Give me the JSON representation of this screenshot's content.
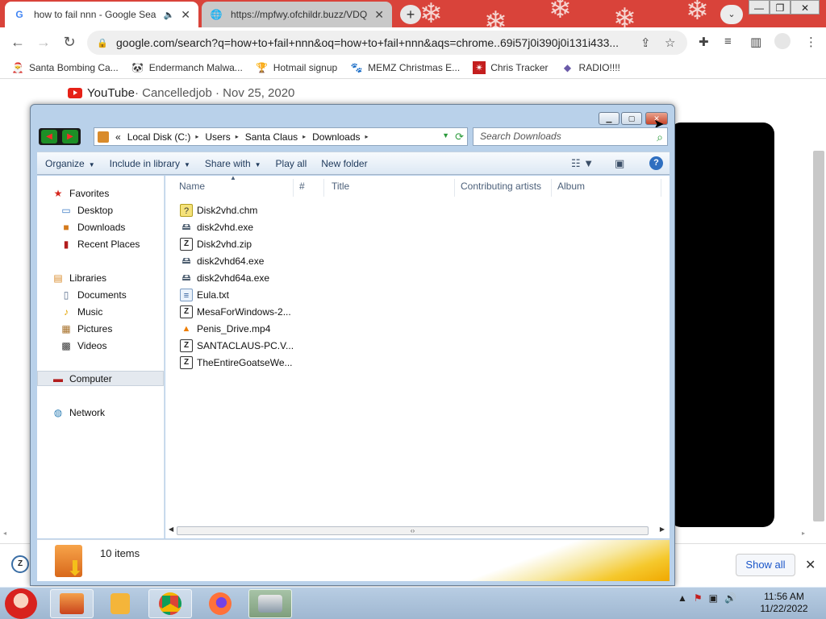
{
  "browser": {
    "tabs": [
      {
        "title": "how to fail nnn - Google Sea",
        "favicon": "G",
        "audio_icon": "🔈",
        "close": "✕"
      },
      {
        "title": "https://mpfwy.ofchildr.buzz/VDQ",
        "favicon": "🌐",
        "close": "✕"
      }
    ],
    "new_tab": "+",
    "tab_search": "⌄",
    "window_controls": {
      "minimize": "—",
      "maximize": "❐",
      "close": "✕"
    },
    "address_url": "google.com/search?q=how+to+fail+nnn&oq=how+to+fail+nnn&aqs=chrome..69i57j0i390j0i131i433...",
    "lock_icon": "🔒",
    "nav": {
      "back": "←",
      "forward": "→",
      "reload": "↻"
    },
    "bookmarks": [
      {
        "label": "Santa Bombing Ca...",
        "icon": "🎅"
      },
      {
        "label": "Endermanch Malwa...",
        "icon": "🐼"
      },
      {
        "label": "Hotmail signup",
        "icon": "🏆"
      },
      {
        "label": "MEMZ Christmas E...",
        "icon": "🐾"
      },
      {
        "label": "Chris Tracker",
        "icon": "✴"
      },
      {
        "label": "RADIO!!!!",
        "icon": "◆"
      }
    ],
    "page": {
      "yt_source": "YouTube",
      "yt_meta": " · Cancelledjob · Nov 25, 2020"
    },
    "downloads_bar": {
      "show_all": "Show all",
      "close": "✕",
      "file_icon": "Z"
    }
  },
  "explorer": {
    "breadcrumb": [
      "Local Disk (C:)",
      "Users",
      "Santa Claus",
      "Downloads"
    ],
    "breadcrumb_prefix": "«",
    "search_placeholder": "Search Downloads",
    "commands": {
      "organize": "Organize",
      "include_in_library": "Include in library",
      "share_with": "Share with",
      "play_all": "Play all",
      "new_folder": "New folder"
    },
    "nav": {
      "favorites": "Favorites",
      "desktop": "Desktop",
      "downloads": "Downloads",
      "recent_places": "Recent Places",
      "libraries": "Libraries",
      "documents": "Documents",
      "music": "Music",
      "pictures": "Pictures",
      "videos": "Videos",
      "computer": "Computer",
      "network": "Network"
    },
    "columns": {
      "name": "Name",
      "number": "#",
      "title": "Title",
      "contributing_artists": "Contributing artists",
      "album": "Album"
    },
    "files": [
      {
        "name": "Disk2vhd.chm",
        "type": "chm"
      },
      {
        "name": "disk2vhd.exe",
        "type": "exe"
      },
      {
        "name": "Disk2vhd.zip",
        "type": "zip"
      },
      {
        "name": "disk2vhd64.exe",
        "type": "exe"
      },
      {
        "name": "disk2vhd64a.exe",
        "type": "exe"
      },
      {
        "name": "Eula.txt",
        "type": "txt"
      },
      {
        "name": "MesaForWindows-2...",
        "type": "zip"
      },
      {
        "name": "Penis_Drive.mp4",
        "type": "vlc"
      },
      {
        "name": "SANTACLAUS-PC.V...",
        "type": "zip"
      },
      {
        "name": "TheEntireGoatseWe...",
        "type": "zip"
      }
    ],
    "item_count": "10 items"
  },
  "taskbar": {
    "clock_time": "11:56 AM",
    "clock_date": "11/22/2022"
  },
  "colors": {
    "tabstrip": "#d9433a",
    "explorer_frame": "#b9d1ea",
    "taskbar": "#a9c0da"
  }
}
